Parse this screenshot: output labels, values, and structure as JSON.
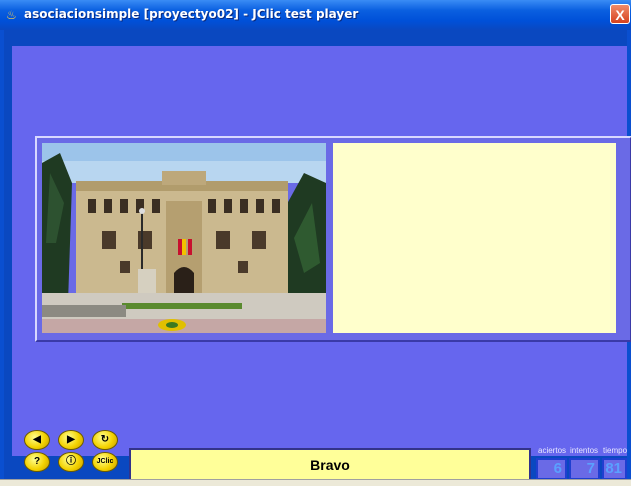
{
  "window": {
    "title": "asociacionsimple [proyectyo02] - JClic test player",
    "close_label": "X"
  },
  "activity": {
    "image_alt": "Colegio de San Ildefonso facade",
    "answer_text": ""
  },
  "controls": {
    "prev_icon": "◀",
    "next_icon": "▶",
    "reset_icon": "↻",
    "help_icon": "?",
    "info_icon": "ⓘ",
    "jclic_logo": "JClic"
  },
  "message": "Bravo",
  "counters": {
    "aciertos_label": "aciertos",
    "aciertos": "6",
    "intentos_label": "intentos",
    "intentos": "7",
    "tiempo_label": "tiempo",
    "tiempo": "81"
  },
  "colors": {
    "canvas": "#6666ee",
    "answer_cell": "#ffffcc",
    "message_bg": "#ffff99",
    "titlebar": "#0050d8"
  }
}
